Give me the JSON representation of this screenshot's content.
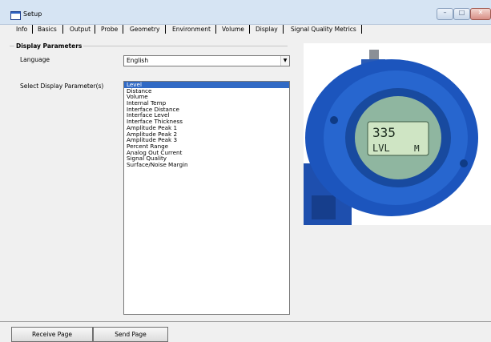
{
  "window": {
    "title": "Setup"
  },
  "tabs": [
    {
      "label": "Info"
    },
    {
      "label": "Basics"
    },
    {
      "label": "Output"
    },
    {
      "label": "Probe"
    },
    {
      "label": "Geometry"
    },
    {
      "label": "Environment"
    },
    {
      "label": "Volume"
    },
    {
      "label": "Display"
    },
    {
      "label": "Signal Quality Metrics"
    }
  ],
  "display_parameters": {
    "group_title": "Display Parameters",
    "language_label": "Language",
    "language_value": "English",
    "select_label": "Select Display Parameter(s)",
    "options": [
      "Level",
      "Distance",
      "Volume",
      "Internal Temp",
      "Interface Distance",
      "Interface Level",
      "Interface Thickness",
      "Amplitude Peak 1",
      "Amplitude Peak 2",
      "Amplitude Peak 3",
      "Percent Range",
      "Analog Out Current",
      "Signal Quality",
      "Surface/Noise Margin"
    ],
    "selected_index": 0
  },
  "device_image": {
    "display_line1": "335",
    "display_line2": "LVL",
    "display_unit": "M"
  },
  "footer": {
    "receive_label": "Receive Page",
    "send_label": "Send Page"
  },
  "colors": {
    "selection": "#316ac5",
    "device_blue": "#1f5fc4",
    "lcd_green": "#cfe5c4"
  }
}
